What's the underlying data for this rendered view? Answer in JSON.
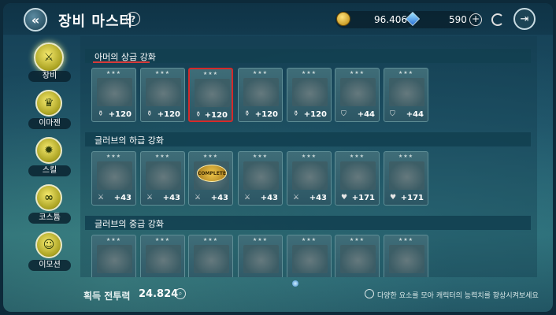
{
  "header": {
    "title": "장비 마스터",
    "back_icon": "back-arrow-icon",
    "gold": "96.406",
    "gems": "590"
  },
  "sidebar": {
    "items": [
      {
        "label": "장비",
        "icon": "equipment-icon",
        "active": true
      },
      {
        "label": "이마젠",
        "icon": "imagen-icon",
        "active": false
      },
      {
        "label": "스킬",
        "icon": "skill-icon",
        "active": false
      },
      {
        "label": "코스튬",
        "icon": "costume-icon",
        "active": false
      },
      {
        "label": "이모션",
        "icon": "emotion-icon",
        "active": false
      }
    ]
  },
  "sections": [
    {
      "title": "아머의 상급 강화",
      "cards": [
        {
          "value": "+120"
        },
        {
          "value": "+120"
        },
        {
          "value": "+120",
          "selected": true
        },
        {
          "value": "+120"
        },
        {
          "value": "+120"
        },
        {
          "value": "+44"
        },
        {
          "value": "+44"
        }
      ]
    },
    {
      "title": "글러브의 하급 강화",
      "cards": [
        {
          "value": "+43"
        },
        {
          "value": "+43"
        },
        {
          "value": "+43",
          "badge": "COMPLETE"
        },
        {
          "value": "+43"
        },
        {
          "value": "+43"
        },
        {
          "value": "+171"
        },
        {
          "value": "+171"
        }
      ]
    },
    {
      "title": "글러브의 중급 강화",
      "cards": [
        {},
        {},
        {},
        {},
        {},
        {},
        {}
      ]
    }
  ],
  "footer": {
    "power_label": "획득 전투력",
    "power_value": "24.824",
    "tip": "다양한 요소를 모아 캐릭터의 능력치를 향상시켜보세요"
  },
  "colors": {
    "selection_border": "#d42a2a",
    "section_underline": "#d83a3a",
    "sidebar_icon": "#f6ea6e"
  }
}
